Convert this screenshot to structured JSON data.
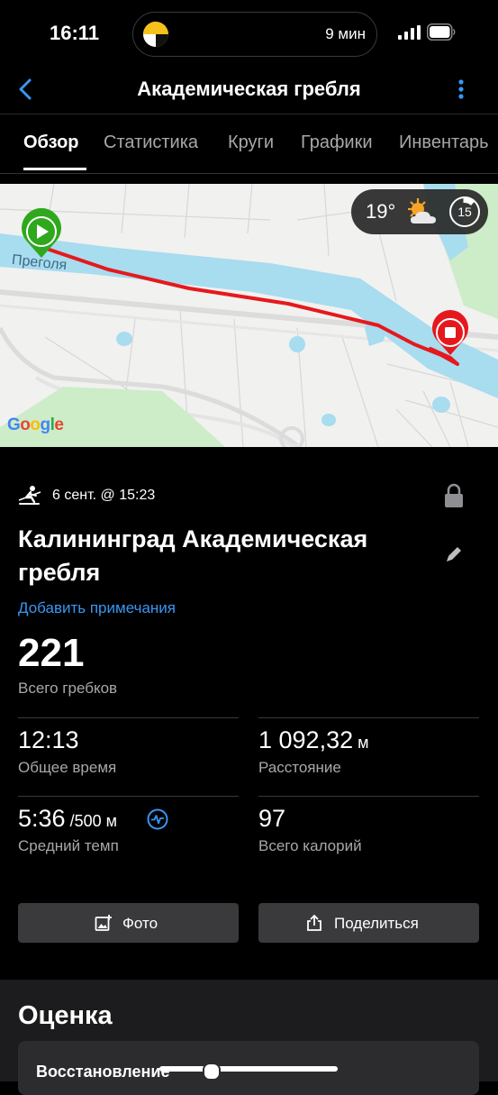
{
  "status_bar": {
    "time": "16:11",
    "activity_minutes": "9 мин"
  },
  "nav": {
    "title": "Академическая гребля"
  },
  "tabs": [
    {
      "label": "Обзор",
      "active": true
    },
    {
      "label": "Статистика"
    },
    {
      "label": "Круги"
    },
    {
      "label": "Графики"
    },
    {
      "label": "Инвентарь"
    }
  ],
  "map": {
    "river_label": "Преголя",
    "weather": {
      "temperature": "19°",
      "wind": "15",
      "icon": "partly-cloudy-icon"
    },
    "attribution": "Google"
  },
  "activity": {
    "icon": "rowing-icon",
    "date": "6 сент. @ 15:23",
    "name": "Калининград Академическая гребля",
    "add_notes": "Добавить примечания",
    "strokes_value": "221",
    "strokes_label": "Всего гребков"
  },
  "stats": [
    {
      "value": "12:13",
      "unit": "",
      "label": "Общее время"
    },
    {
      "value": "1 092,32",
      "unit": " м",
      "label": "Расстояние"
    },
    {
      "value": "5:36",
      "unit": " /500 м",
      "label": "Средний темп"
    },
    {
      "value": "97",
      "unit": "",
      "label": "Всего калорий"
    }
  ],
  "actions": {
    "photo": "Фото",
    "share": "Поделиться"
  },
  "evaluation": {
    "title": "Оценка",
    "recovery": "Восстановление"
  },
  "colors": {
    "accent": "#3a96f2",
    "route": "#e5191d",
    "start": "#2fa81d",
    "water": "#a8dcef"
  }
}
